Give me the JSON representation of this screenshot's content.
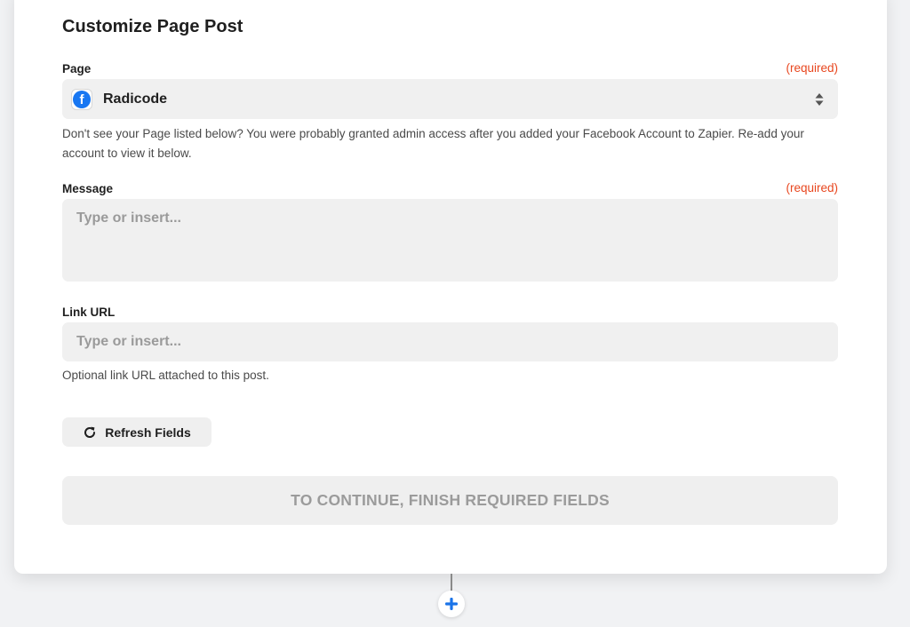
{
  "form": {
    "title": "Customize Page Post",
    "page_field": {
      "label": "Page",
      "required_text": "(required)",
      "selected_value": "Radicode",
      "help_text": "Don't see your Page listed below? You were probably granted admin access after you added your Facebook Account to Zapier. Re-add your account to view it below."
    },
    "message_field": {
      "label": "Message",
      "required_text": "(required)",
      "placeholder": "Type or insert..."
    },
    "link_url_field": {
      "label": "Link URL",
      "placeholder": "Type or insert...",
      "help_text": "Optional link URL attached to this post."
    },
    "refresh_label": "Refresh Fields",
    "continue_label": "TO CONTINUE, FINISH REQUIRED FIELDS"
  },
  "icons": {
    "facebook": "facebook-icon",
    "sort": "sort-arrows-icon",
    "refresh": "refresh-icon",
    "add": "plus-icon"
  },
  "colors": {
    "required": "#e8461e",
    "facebook_blue": "#1877f2",
    "add_blue": "#1a73e8"
  }
}
